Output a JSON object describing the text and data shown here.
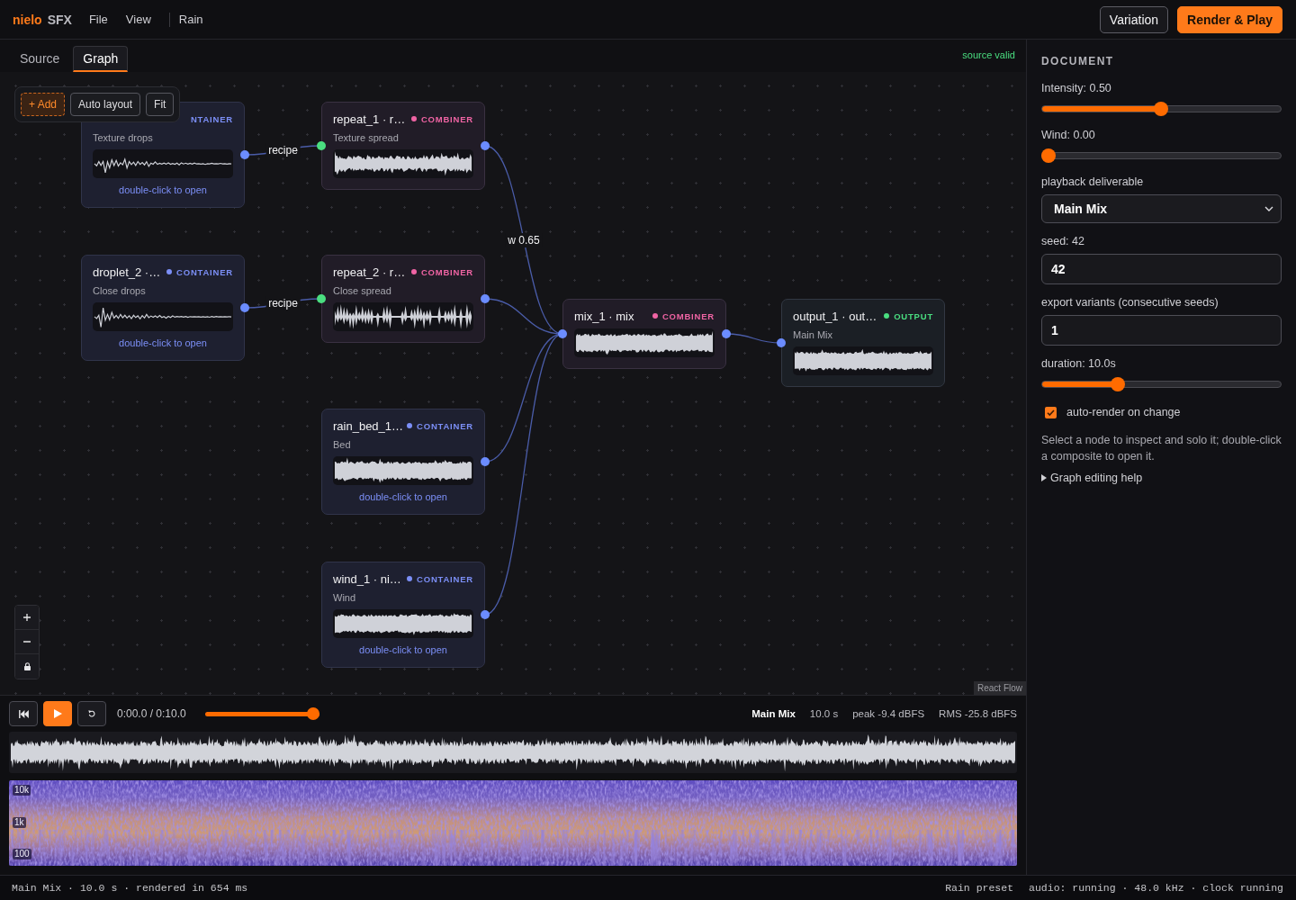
{
  "app": {
    "logo": {
      "brand": "nielo",
      "product": "SFX"
    },
    "menu": [
      {
        "label": "File"
      },
      {
        "label": "View"
      }
    ],
    "document": "Rain",
    "buttons": [
      {
        "label": "Variation",
        "kind": "secondary"
      },
      {
        "label": "Render & Play",
        "kind": "primary"
      }
    ]
  },
  "tabs": [
    {
      "label": "Source",
      "selected": false
    },
    {
      "label": "Graph",
      "selected": true
    }
  ],
  "validation": "source valid",
  "canvas": {
    "toolbar": [
      {
        "label": "+ Add",
        "kind": "add"
      },
      {
        "label": "Auto layout",
        "kind": "layout"
      },
      {
        "label": "Fit",
        "kind": "fit"
      }
    ],
    "nodes": [
      {
        "title": "output_1 · out…",
        "badge": "OUTPUT",
        "kind": "output",
        "covered": false,
        "subtitle": "Main Mix",
        "waveform": {
          "kind": "dense"
        },
        "input_port": {
          "color": "#6b8cff"
        },
        "inputs": [
          {
            "title": "mix_1 · mix",
            "badge": "COMBINER",
            "kind": "combiner",
            "covered": false,
            "waveform": {
              "kind": "dense"
            },
            "input_port": {
              "color": "#6b8cff"
            },
            "inputs": [
              {
                "title": "repeat_1 · r…",
                "badge": "COMBINER",
                "kind": "combiner",
                "covered": false,
                "subtitle": "Texture spread",
                "waveform": {
                  "kind": "spiky"
                },
                "input_port": {
                  "color": "#4ade80"
                },
                "edge_label": "w 0.65",
                "inputs": [
                  {
                    "badge": "NTAINER",
                    "kind": "container",
                    "covered": true,
                    "subtitle": "Texture drops",
                    "waveform": {
                      "kind": "decay"
                    },
                    "action": "double-click to open",
                    "edge_label": "recipe"
                  }
                ]
              },
              {
                "title": "repeat_2 · r…",
                "badge": "COMBINER",
                "kind": "combiner",
                "covered": false,
                "subtitle": "Close spread",
                "waveform": {
                  "kind": "pulses"
                },
                "input_port": {
                  "color": "#4ade80"
                },
                "inputs": [
                  {
                    "title": "droplet_2 ·…",
                    "badge": "CONTAINER",
                    "kind": "container",
                    "covered": false,
                    "subtitle": "Close drops",
                    "waveform": {
                      "kind": "decay"
                    },
                    "action": "double-click to open",
                    "edge_label": "recipe"
                  }
                ]
              },
              {
                "title": "rain_bed_1…",
                "badge": "CONTAINER",
                "kind": "container",
                "covered": false,
                "subtitle": "Bed",
                "waveform": {
                  "kind": "dense"
                },
                "action": "double-click to open"
              },
              {
                "title": "wind_1 · ni…",
                "badge": "CONTAINER",
                "kind": "container",
                "covered": false,
                "subtitle": "Wind",
                "waveform": {
                  "kind": "dense"
                },
                "action": "double-click to open"
              }
            ]
          }
        ]
      }
    ],
    "attribution": "React Flow"
  },
  "document_panel": {
    "title": "DOCUMENT",
    "controls": [
      {
        "kind": "slider",
        "label": "Intensity: 0.50",
        "level": 0.5
      },
      {
        "kind": "slider",
        "label": "Wind: 0.00",
        "level": 0
      },
      {
        "kind": "select",
        "label": "playback deliverable",
        "value": "Main Mix"
      },
      {
        "kind": "number",
        "label": "seed: 42",
        "value": "42"
      },
      {
        "kind": "number",
        "label": "export variants (consecutive seeds)",
        "value": "1"
      },
      {
        "kind": "slider",
        "label": "duration: 10.0s",
        "level": 0.31
      },
      {
        "kind": "checkbox",
        "label": "auto-render on change",
        "checked": true
      }
    ],
    "help": "Select a node to inspect and solo it; double-click a composite to open it.",
    "disclosure": {
      "label": "Graph editing help",
      "expanded": false
    }
  },
  "player": {
    "time": "0:00.0 / 0:10.0",
    "slider": {
      "level": 1
    },
    "deliverable": "Main Mix",
    "stats": [
      "10.0 s",
      "peak -9.4 dBFS",
      "RMS -25.8 dBFS"
    ],
    "spectrogram_labels": [
      "10k",
      "1k",
      "100"
    ]
  },
  "status_bar": {
    "summary": "Main Mix · 10.0 s · rendered in 654 ms",
    "preset": "Rain preset",
    "engine": "audio: running · 48.0 kHz · clock running"
  }
}
